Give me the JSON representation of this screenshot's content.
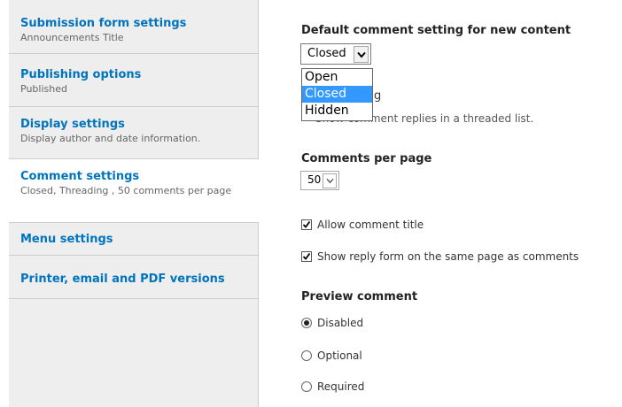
{
  "colors": {
    "link_blue": "#0074bd",
    "tabs_bg": "#eeeeee",
    "selection_blue": "#3399ff"
  },
  "tabs": [
    {
      "title": "Submission form settings",
      "summary": "Announcements Title"
    },
    {
      "title": "Publishing options",
      "summary": "Published"
    },
    {
      "title": "Display settings",
      "summary": "Display author and date information."
    },
    {
      "title": "Comment settings",
      "summary": "Closed, Threading , 50 comments per page",
      "active": true
    },
    {
      "title": "Menu settings",
      "summary": ""
    },
    {
      "title": "Printer, email and PDF versions",
      "summary": ""
    }
  ],
  "default_comment": {
    "label": "Default comment setting for new content",
    "selected": "Closed",
    "options": [
      "Open",
      "Closed",
      "Hidden"
    ],
    "icon": "chevron-down-icon"
  },
  "threading": {
    "label_partial": "g",
    "description_partial": "Show comment replies in a threaded list."
  },
  "comments_per_page": {
    "label": "Comments per page",
    "value": "50",
    "icon": "chevron-down-icon"
  },
  "allow_title": {
    "label": "Allow comment title",
    "checked": true
  },
  "reply_form": {
    "label": "Show reply form on the same page as comments",
    "checked": true
  },
  "preview_comment": {
    "label": "Preview comment",
    "options": [
      "Disabled",
      "Optional",
      "Required"
    ],
    "selected": "Disabled"
  }
}
